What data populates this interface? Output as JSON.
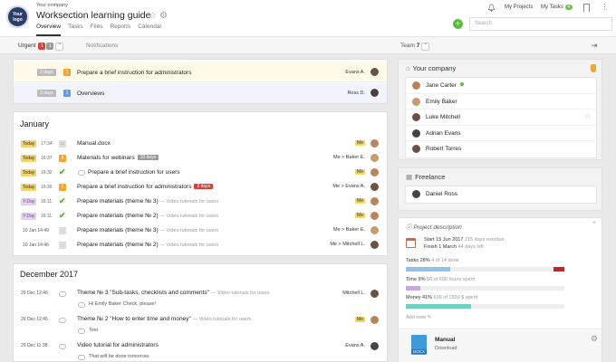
{
  "header": {
    "logo_text": "Your logo",
    "company_name": "Your company",
    "project_title": "Worksection learning guide",
    "tabs": [
      {
        "label": "Overview",
        "active": true
      },
      {
        "label": "Tasks",
        "active": false
      },
      {
        "label": "Files",
        "active": false
      },
      {
        "label": "Reports",
        "active": false
      },
      {
        "label": "Calendar",
        "active": false
      }
    ],
    "my_projects": "My Projects",
    "my_tasks": "My Tasks",
    "my_tasks_count": "4",
    "search_placeholder": "Search",
    "add_symbol": "+"
  },
  "subbar": {
    "urgent_label": "Urgent",
    "urgent_red": "1",
    "urgent_gray": "1",
    "notifications_label": "Notifications",
    "team_label": "Team",
    "team_count": "7"
  },
  "pinned_tasks": [
    {
      "days": "2 days",
      "priority": "1",
      "title": "Prepare a brief instruction for administrators",
      "assignee": "Evans A."
    },
    {
      "days": "3 days",
      "priority": "1",
      "title": "Overviews",
      "assignee": "Ross D."
    }
  ],
  "january": {
    "title": "January",
    "rows": [
      {
        "date": "Today",
        "date_style": "today",
        "time": "17:34",
        "icon": "doc",
        "title": "Manual.docx",
        "tag": "",
        "tag_style": "",
        "sub": "",
        "assignee": "",
        "me": "Me"
      },
      {
        "date": "Today",
        "date_style": "today",
        "time": "16:37",
        "icon": "prio",
        "prio": "8",
        "title": "Materials for webinars",
        "tag": "10 days",
        "tag_style": "gray",
        "sub": "",
        "assignee": "Me > Baker E.",
        "me": ""
      },
      {
        "date": "Today",
        "date_style": "today",
        "time": "16:32",
        "icon": "check",
        "title": "Prepare a brief instruction for users",
        "tag": "",
        "tag_style": "",
        "sub": "",
        "assignee": "",
        "me": "Me"
      },
      {
        "date": "Today",
        "date_style": "today",
        "time": "16:26",
        "icon": "prio",
        "prio": "1",
        "title": "Prepare a brief instruction for administrators",
        "tag": "2 days",
        "tag_style": "red",
        "sub": "",
        "assignee": "Me > Evans A.",
        "me": ""
      },
      {
        "date": "Y-Day",
        "date_style": "yday",
        "time": "16:11",
        "icon": "check",
        "title": "Prepare materials (theme № 3)",
        "tag": "",
        "tag_style": "",
        "sub": "— Video tutorials for users",
        "assignee": "",
        "me": "Me"
      },
      {
        "date": "Y-Day",
        "date_style": "yday",
        "time": "16:11",
        "icon": "check",
        "title": "Prepare materials (theme № 2)",
        "tag": "",
        "tag_style": "",
        "sub": "— Video tutorials for users",
        "assignee": "",
        "me": "Me"
      },
      {
        "date": "10 Jan",
        "date_style": "plain",
        "time": "14:49",
        "icon": "prio",
        "prio": "",
        "title": "Prepare materials (theme № 3)",
        "tag": "",
        "tag_style": "",
        "sub": "— Video tutorials for users",
        "assignee": "Me > Baker E.",
        "me": ""
      },
      {
        "date": "10 Jan",
        "date_style": "plain",
        "time": "14:46",
        "icon": "prio",
        "prio": "",
        "title": "Prepare materials (theme № 2)",
        "tag": "",
        "tag_style": "",
        "sub": "— Video tutorials for users",
        "assignee": "Me > Mitchell L.",
        "me": ""
      }
    ]
  },
  "december": {
    "title": "December 2017",
    "rows": [
      {
        "date": "29 Dec",
        "time": "12:46",
        "title": "Theme № 3 \"Sub-tasks, checklists and comments\"",
        "sub": "— Video tutorials for users",
        "assignee": "Mitchell L.",
        "me": "",
        "comment": "Hi Emily Baker Check, please!"
      },
      {
        "date": "29 Dec",
        "time": "12:45",
        "title": "Theme № 2 \"How to enter time and money\"",
        "sub": "— Video tutorials for users",
        "assignee": "",
        "me": "Me",
        "comment": "Text"
      },
      {
        "date": "29 Dec",
        "time": "11:38",
        "title": "Video tutorial for administrators",
        "sub": "",
        "assignee": "Evans A.",
        "me": "",
        "comment": "That will be done tomorrow."
      }
    ]
  },
  "your_company": {
    "title": "Your company",
    "members": [
      {
        "name": "Jane Carter",
        "online": true,
        "star": false
      },
      {
        "name": "Emily Baker",
        "online": false,
        "star": false
      },
      {
        "name": "Luke Mitchell",
        "online": false,
        "star": true
      },
      {
        "name": "Adrian Evans",
        "online": false,
        "star": false
      },
      {
        "name": "Robert Torres",
        "online": false,
        "star": false
      }
    ]
  },
  "freelance": {
    "title": "Freelance",
    "members": [
      {
        "name": "Daniel Ross"
      }
    ]
  },
  "project_description": {
    "title": "Project description",
    "start_label": "Start 15 Jun 2017",
    "start_note": "215 days overdue",
    "finish_label": "Finish 1 March",
    "finish_note": "44 days left",
    "tasks_label": "Tasks 28%",
    "tasks_note": "4 of 14 done",
    "tasks_progress": 0.28,
    "time_label": "Time 9%",
    "time_note": "56 of 600 hours spent",
    "time_progress": 0.09,
    "money_label": "Money 41%",
    "money_note": "619 of 1500 $ spent",
    "money_progress": 0.41,
    "add_note": "Add note",
    "file_title": "Manual",
    "file_action": "Download",
    "file_type": "DOCX"
  },
  "colors": {
    "accent_green": "#5fba42",
    "urgent_red": "#d9403a",
    "priority_orange": "#f5a52d",
    "tasks_bar": "#8fc3ea",
    "time_bar": "#c9a6df",
    "money_bar": "#6fd1bf"
  }
}
